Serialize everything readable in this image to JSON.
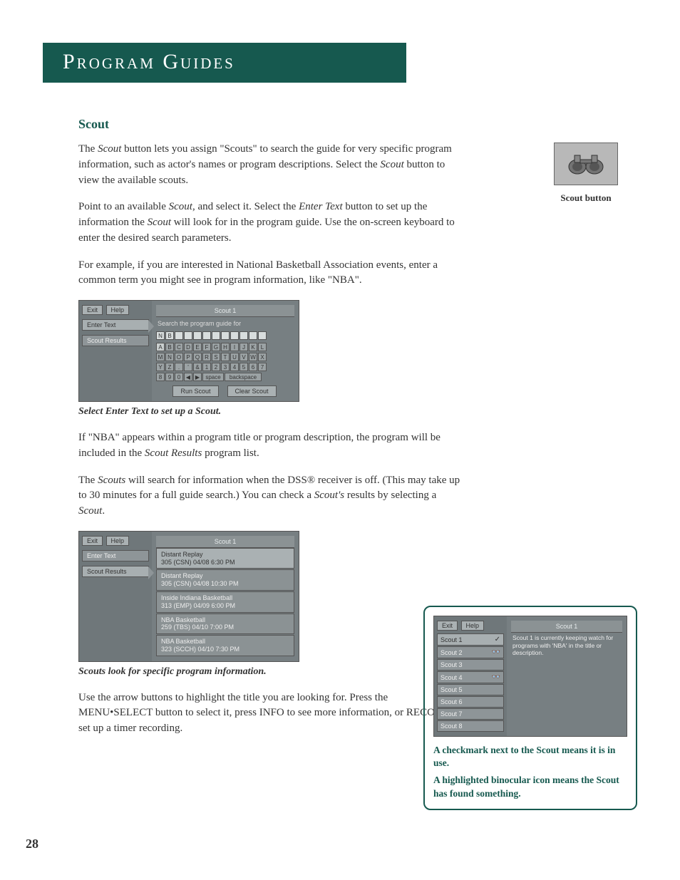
{
  "header": {
    "title": "Program Guides"
  },
  "section": {
    "heading": "Scout"
  },
  "paragraphs": {
    "p1a": "The ",
    "p1b": "Scout",
    "p1c": " button lets you assign \"Scouts\" to search the guide for very specific program information, such as actor's names or program descriptions. Select the ",
    "p1d": "Scout",
    "p1e": " button to view the available scouts.",
    "p2a": "Point to an available ",
    "p2b": "Scout",
    "p2c": ", and select it. Select the ",
    "p2d": "Enter Text",
    "p2e": " button to set up the information the ",
    "p2f": "Scout",
    "p2g": " will look for in the program guide. Use the on-screen keyboard to enter the desired search parameters.",
    "p3": "For example, if you are interested in National Basketball Association events, enter a common term you might see in program information, like \"NBA\".",
    "cap1": "Select Enter Text to set up a Scout.",
    "p4a": "If \"NBA\" appears within a program title or program description, the program will be included in the ",
    "p4b": "Scout Results",
    "p4c": " program list.",
    "p5a": "The ",
    "p5b": "Scouts",
    "p5c": " will search for information when the DSS® receiver is off. (This may take up to 30 minutes for a full guide search.) You can check a ",
    "p5d": "Scout's",
    "p5e": " results by selecting a ",
    "p5f": "Scout",
    "p5g": ".",
    "cap2": "Scouts look for specific program information.",
    "p6": "Use the arrow buttons to highlight the title you are looking for. Press the MENU•SELECT button to select it, press INFO to see more information, or RECORD to set up a timer recording."
  },
  "side": {
    "label": "Scout button"
  },
  "tv1": {
    "exit": "Exit",
    "help": "Help",
    "menu1": "Enter Text",
    "menu2": "Scout Results",
    "title": "Scout 1",
    "sub": "Search the program guide for",
    "entry": [
      "N",
      "B"
    ],
    "row1": [
      "A",
      "B",
      "C",
      "D",
      "E",
      "F",
      "G",
      "H",
      "I",
      "J",
      "K",
      "L"
    ],
    "row2": [
      "M",
      "N",
      "O",
      "P",
      "Q",
      "R",
      "S",
      "T",
      "U",
      "V",
      "W",
      "X"
    ],
    "row3": [
      "Y",
      "Z",
      ".",
      "'",
      "&",
      "1",
      "2",
      "3",
      "4",
      "5",
      "6",
      "7"
    ],
    "row4": [
      "8",
      "9",
      "0",
      "◀",
      "▶"
    ],
    "space": "space",
    "backspace": "backspace",
    "run": "Run Scout",
    "clear": "Clear Scout"
  },
  "tv2": {
    "exit": "Exit",
    "help": "Help",
    "menu1": "Enter Text",
    "menu2": "Scout Results",
    "title": "Scout 1",
    "results": [
      {
        "t": "Distant Replay",
        "d": "305 (CSN)  04/08  6:30 PM"
      },
      {
        "t": "Distant Replay",
        "d": "305 (CSN)  04/08  10:30 PM"
      },
      {
        "t": "Inside Indiana Basketball",
        "d": "313 (EMP)  04/09  6:00 PM"
      },
      {
        "t": "NBA Basketball",
        "d": "259 (TBS)  04/10  7:00 PM"
      },
      {
        "t": "NBA Basketball",
        "d": "323 (SCCH)  04/10  7:30 PM"
      }
    ]
  },
  "callout": {
    "tv": {
      "exit": "Exit",
      "help": "Help",
      "title": "Scout 1",
      "desc": "Scout 1 is currently keeping watch for programs with 'NBA' in the title or description.",
      "scouts": [
        "Scout 1",
        "Scout 2",
        "Scout 3",
        "Scout 4",
        "Scout 5",
        "Scout 6",
        "Scout 7",
        "Scout 8"
      ]
    },
    "note1": "A checkmark next to the Scout means it is in use.",
    "note2": "A highlighted binocular icon means the Scout has found something."
  },
  "page": "28"
}
